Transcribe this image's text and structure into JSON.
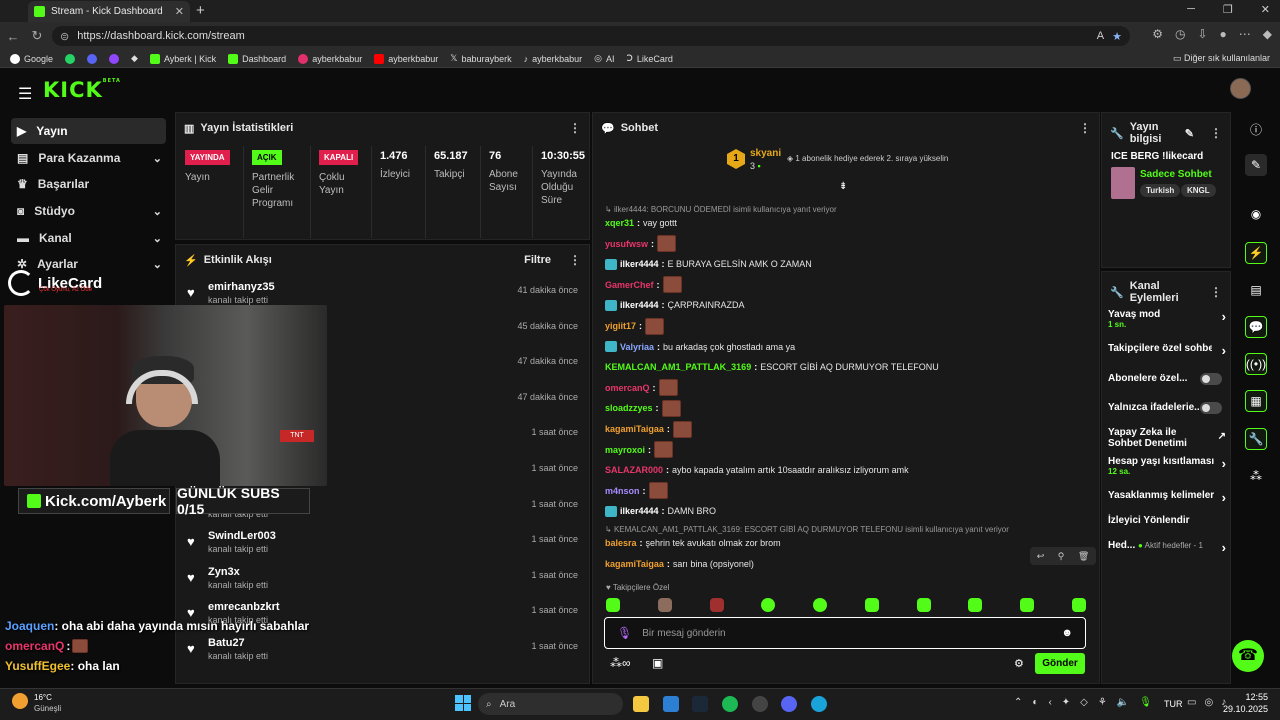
{
  "browser": {
    "tab_title": "Stream - Kick Dashboard",
    "new_tab": "+",
    "url": "https://dashboard.kick.com/stream",
    "bookmarks": [
      "Google",
      "Ayberk | Kick",
      "Dashboard",
      "ayberkbabur",
      "ayberkbabur",
      "baburayberk",
      "ayberkbabur",
      "AI",
      "LikeCard"
    ],
    "other_bookmarks": "Diğer sık kullanılanlar"
  },
  "app": {
    "logo": "KICK",
    "logo_sup": "BETA",
    "sidebar": [
      {
        "label": "Yayın",
        "chevron": false
      },
      {
        "label": "Para Kazanma",
        "chevron": true
      },
      {
        "label": "Başarılar",
        "chevron": false
      },
      {
        "label": "Stüdyo",
        "chevron": true
      },
      {
        "label": "Kanal",
        "chevron": true
      },
      {
        "label": "Ayarlar",
        "chevron": true
      }
    ]
  },
  "stats": {
    "title": "Yayın İstatistikleri",
    "items": [
      {
        "badge": "YAYINDA",
        "label": "Yayın"
      },
      {
        "badge": "AÇIK",
        "label": "Partnerlik Gelir Programı"
      },
      {
        "badge": "KAPALI",
        "label": "Çoklu Yayın"
      },
      {
        "value": "1.476",
        "label": "İzleyici"
      },
      {
        "value": "65.187",
        "label": "Takipçi"
      },
      {
        "value": "76",
        "label": "Abone Sayısı"
      },
      {
        "value": "10:30:55",
        "label": "Yayında Olduğu Süre"
      }
    ]
  },
  "activity": {
    "title": "Etkinlik Akışı",
    "filter": "Filtre",
    "items": [
      {
        "name": "emirhanyz35",
        "sub": "kanalı takip etti",
        "time": "41 dakika önce"
      },
      {
        "name": "",
        "sub": "",
        "time": "45 dakika önce"
      },
      {
        "name": "",
        "sub": "",
        "time": "47 dakika önce"
      },
      {
        "name": "",
        "sub": "",
        "time": "47 dakika önce"
      },
      {
        "name": "",
        "sub": "",
        "time": "1 saat önce"
      },
      {
        "name": "",
        "sub": "",
        "time": "1 saat önce"
      },
      {
        "name": "",
        "sub": "kanalı takip etti",
        "time": "1 saat önce"
      },
      {
        "name": "SwindLer003",
        "sub": "kanalı takip etti",
        "time": "1 saat önce"
      },
      {
        "name": "Zyn3x",
        "sub": "kanalı takip etti",
        "time": "1 saat önce"
      },
      {
        "name": "emrecanbzkrt",
        "sub": "kanalı takip etti",
        "time": "1 saat önce"
      },
      {
        "name": "Batu27",
        "sub": "kanalı takip etti",
        "time": "1 saat önce"
      }
    ]
  },
  "chat": {
    "title": "Sohbet",
    "pinned_user": "skyani",
    "pinned_rank": "1",
    "pinned_count": "3",
    "pinned_text": "1 abonelik hediye ederek 2. sıraya yükselin",
    "messages": [
      {
        "type": "reply",
        "text": "ilker4444: BORCUNU ÖDEMEDİ isimli kullanıcıya yanıt veriyor"
      },
      {
        "user": "xqer31",
        "color": "#53fc18",
        "text": "vay gottt"
      },
      {
        "user": "yusufwsw",
        "color": "#e8366b",
        "text": "",
        "emote": true
      },
      {
        "user": "ilker4444",
        "color": "#ffffff",
        "text": "E BURAYA GELSİN AMK O ZAMAN",
        "badge": true
      },
      {
        "user": "GamerChef",
        "color": "#e8366b",
        "text": "",
        "emote": true
      },
      {
        "user": "ilker4444",
        "color": "#ffffff",
        "text": "ÇARPRAINRAZDA",
        "badge": true
      },
      {
        "user": "yigiit17",
        "color": "#f0a030",
        "text": "",
        "emote": true
      },
      {
        "user": "Valyriaa",
        "color": "#8aa7ff",
        "text": "bu arkadaş çok ghostladı ama ya",
        "badge": true
      },
      {
        "user": "KEMALCAN_AM1_PATTLAK_3169",
        "color": "#53fc18",
        "text": "ESCORT GİBİ AQ DURMUYOR TELEFONU"
      },
      {
        "user": "omercanQ",
        "color": "#e8366b",
        "text": "",
        "emote": true
      },
      {
        "user": "sloadzzyes",
        "color": "#53fc18",
        "text": "",
        "emote": true
      },
      {
        "user": "kagamiTaigaa",
        "color": "#f0a030",
        "text": "",
        "emote": true
      },
      {
        "user": "mayroxoi",
        "color": "#53fc18",
        "text": "",
        "emote": true
      },
      {
        "user": "SALAZAR000",
        "color": "#e8366b",
        "text": "aybo kapada yatalım artık 10saatdır aralıksız izliyorum amk"
      },
      {
        "user": "m4nson",
        "color": "#a78bff",
        "text": "",
        "emote": true
      },
      {
        "user": "ilker4444",
        "color": "#ffffff",
        "text": "DAMN BRO",
        "badge": true
      },
      {
        "type": "reply",
        "text": "KEMALCAN_AM1_PATTLAK_3169: ESCORT GİBİ AQ DURMUYOR TELEFONU isimli kullanıcıya yanıt veriyor"
      },
      {
        "user": "balesra",
        "color": "#f0a030",
        "text": "şehrin tek avukatı olmak zor brom"
      },
      {
        "user": "kagamiTaigaa",
        "color": "#f0a030",
        "text": "sarı bina (opsiyonel)"
      }
    ],
    "followers_only": "Takipçilere Özel",
    "input_placeholder": "Bir mesaj gönderin",
    "send": "Gönder"
  },
  "info": {
    "title": "Yayın bilgisi",
    "stream_title": "ICE BERG !likecard",
    "category": "Sadece Sohbet",
    "tags": [
      "Turkish",
      "KNGL"
    ]
  },
  "actions": {
    "title": "Kanal Eylemleri",
    "items": [
      {
        "label": "Yavaş mod",
        "sub": "1 sn."
      },
      {
        "label": "Takipçilere özel sohbet"
      },
      {
        "label": "Abonelere özel..."
      },
      {
        "label": "Yalnızca ifadelerie..."
      },
      {
        "label": "Yapay Zeka ile Sohbet Denetimi"
      },
      {
        "label": "Hesap yaşı kısıtlaması",
        "sub": "12 sa."
      },
      {
        "label": "Yasaklanmış kelimeler"
      },
      {
        "label": "İzleyici Yönlendir"
      },
      {
        "label": "Hed...",
        "sub": "Aktif hedefler - 1"
      }
    ]
  },
  "overlay": {
    "likecard": "LikeCard",
    "likecard_sub": "Çok Oyunu, Az Öde",
    "kick_url": "Kick.com/Ayberk",
    "subs": "GÜNLÜK SUBS 0/15",
    "chat": [
      {
        "user": "Joaquen",
        "text": ": oha abi daha yayında mısın hayırlı sabahlar",
        "color": "#5aa0ff"
      },
      {
        "user": "omercanQ",
        "text": ":",
        "color": "#e8366b"
      },
      {
        "user": "YusuffEgee",
        "text": ": oha lan",
        "color": "#f0c030"
      }
    ]
  },
  "taskbar": {
    "weather_temp": "16°C",
    "weather_desc": "Güneşli",
    "search": "Ara",
    "lang": "TUR",
    "time": "12:55",
    "date": "29.10.2025"
  }
}
